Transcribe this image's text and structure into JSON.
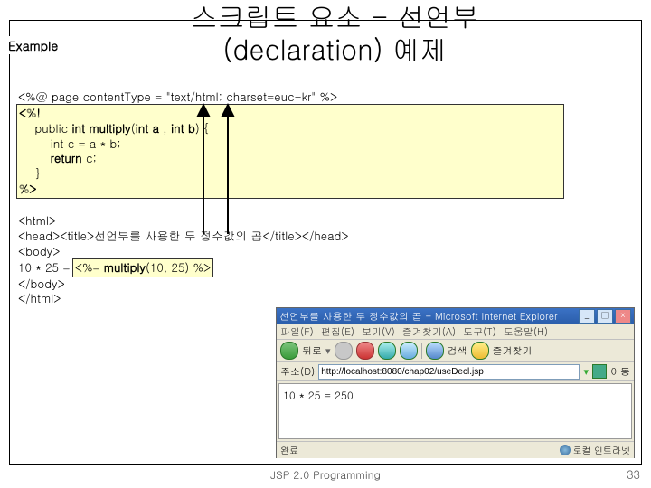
{
  "title_line1": "스크립트 요소 - 선언부",
  "title_line2": "(declaration) 예제",
  "example_label": "Example",
  "code": {
    "l1a": "<%@ page contentType = \"text/html; charset=euc-kr\" %>",
    "l2": "<%!",
    "l3a": "    public ",
    "l3b": "int multiply",
    "l3c": "(",
    "l3d": "int a",
    "l3e": " , ",
    "l3f": "int b",
    "l3g": ") {",
    "l4": "        int c = a * b;",
    "l5a": "        ",
    "l5b": "return",
    "l5c": " c;",
    "l6": "    }",
    "l7": "%>",
    "l8": "<html>",
    "l9": "<head><title>선언부를 사용한 두 정수값의 곱</title></head>",
    "l10": "<body>",
    "l11a": "10 * 25 = ",
    "l11b": "<%= ",
    "l11c": "multiply",
    "l11d": "(10, 25) %>",
    "l12": "</body>",
    "l13": "</html>"
  },
  "browser": {
    "title": "선언부를 사용한 두 정수값의 곱 - Microsoft Internet Explorer",
    "menu": [
      "파일(F)",
      "편집(E)",
      "보기(V)",
      "즐겨찾기(A)",
      "도구(T)",
      "도움말(H)"
    ],
    "toolbar": {
      "back": "뒤로",
      "search": "검색",
      "fav": "즐겨찾기"
    },
    "addr_label": "주소(D)",
    "url": "http://localhost:8080/chap02/useDecl.jsp",
    "go": "이동",
    "content": "10 * 25 = 250",
    "status_done": "완료",
    "status_zone": "로컬 인트라넷"
  },
  "footer": "JSP 2.0 Programming",
  "pagenum": "33"
}
